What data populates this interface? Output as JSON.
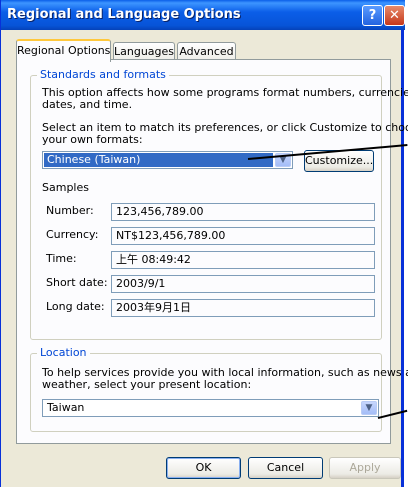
{
  "window": {
    "title": "Regional and Language Options",
    "help_glyph": "?",
    "close_glyph": "✕"
  },
  "tabs": [
    {
      "label": "Regional Options",
      "active": true
    },
    {
      "label": "Languages",
      "active": false
    },
    {
      "label": "Advanced",
      "active": false
    }
  ],
  "standards": {
    "title": "Standards and formats",
    "description": "This option affects how some programs format numbers, currencies, dates, and time.",
    "description_line1": "This option affects how some programs format numbers, currencies,",
    "description_line2": "dates, and time.",
    "instruction_line1": "Select an item to match its preferences, or click Customize to choose",
    "instruction_line2": "your own formats:",
    "selected_format": "Chinese (Taiwan)",
    "customize_label": "Customize..."
  },
  "samples": {
    "title": "Samples",
    "rows": [
      {
        "label": "Number:",
        "value": "123,456,789.00"
      },
      {
        "label": "Currency:",
        "value": "NT$123,456,789.00"
      },
      {
        "label": "Time:",
        "value": "上午 08:49:42"
      },
      {
        "label": "Short date:",
        "value": "2003/9/1"
      },
      {
        "label": "Long date:",
        "value": "2003年9月1日"
      }
    ]
  },
  "location": {
    "title": "Location",
    "description_line1": "To help services provide you with local information, such as news and",
    "description_line2": "weather, select your present location:",
    "selected": "Taiwan"
  },
  "footer": {
    "ok_label": "OK",
    "cancel_label": "Cancel",
    "apply_label": "Apply"
  },
  "colors": {
    "title_bar": "#0a5fe8",
    "group_title": "#0046d5",
    "selection": "#316ac5",
    "dialog_bg": "#ece9d8"
  }
}
